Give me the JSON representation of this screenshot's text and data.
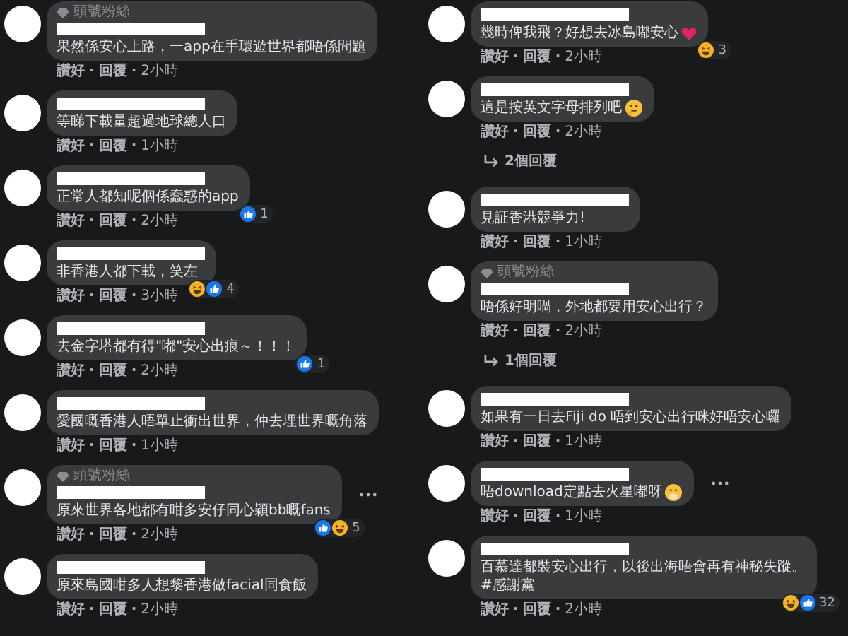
{
  "columns": [
    {
      "comments": [
        {
          "badge": "頭號粉絲",
          "text": "果然係安心上路，一app在手環遊世界都唔係問題",
          "actions": [
            {
              "kind": "like",
              "text": "讚好"
            },
            {
              "kind": "sep",
              "text": "·"
            },
            {
              "kind": "reply",
              "text": "回覆"
            },
            {
              "kind": "sep",
              "text": "·"
            },
            {
              "kind": "time",
              "text": "2小時"
            }
          ]
        },
        {
          "text": "等睇下載量超過地球總人口",
          "actions": [
            {
              "kind": "like",
              "text": "讚好"
            },
            {
              "kind": "sep",
              "text": "·"
            },
            {
              "kind": "reply",
              "text": "回覆"
            },
            {
              "kind": "sep",
              "text": "·"
            },
            {
              "kind": "time",
              "text": "1小時"
            }
          ]
        },
        {
          "text": "正常人都知呢個係蠢惑的app",
          "reactions": [
            {
              "kind": "like"
            }
          ],
          "reaction_count": "1",
          "actions": [
            {
              "kind": "like",
              "text": "讚好"
            },
            {
              "kind": "sep",
              "text": "·"
            },
            {
              "kind": "reply",
              "text": "回覆"
            },
            {
              "kind": "sep",
              "text": "·"
            },
            {
              "kind": "time",
              "text": "2小時"
            }
          ]
        },
        {
          "text": "非香港人都下載，笑左",
          "reactions": [
            {
              "kind": "haha"
            },
            {
              "kind": "like"
            }
          ],
          "reaction_count": "4",
          "actions": [
            {
              "kind": "like",
              "text": "讚好"
            },
            {
              "kind": "sep",
              "text": "·"
            },
            {
              "kind": "reply",
              "text": "回覆"
            },
            {
              "kind": "sep",
              "text": "·"
            },
            {
              "kind": "time",
              "text": "3小時"
            }
          ]
        },
        {
          "text": "去金字塔都有得\"嘟\"安心出痕～！！！",
          "reactions": [
            {
              "kind": "like"
            }
          ],
          "reaction_count": "1",
          "actions": [
            {
              "kind": "like",
              "text": "讚好"
            },
            {
              "kind": "sep",
              "text": "·"
            },
            {
              "kind": "reply",
              "text": "回覆"
            },
            {
              "kind": "sep",
              "text": "·"
            },
            {
              "kind": "time",
              "text": "2小時"
            }
          ]
        },
        {
          "text": "愛國嘅香港人唔單止衝出世界，仲去埋世界嘅角落",
          "actions": [
            {
              "kind": "like",
              "text": "讚好"
            },
            {
              "kind": "sep",
              "text": "·"
            },
            {
              "kind": "reply",
              "text": "回覆"
            },
            {
              "kind": "sep",
              "text": "·"
            },
            {
              "kind": "time",
              "text": "1小時"
            }
          ]
        },
        {
          "badge": "頭號粉絲",
          "text": "原來世界各地都有咁多安仔同心穎bb嘅fans",
          "reactions": [
            {
              "kind": "like"
            },
            {
              "kind": "haha"
            }
          ],
          "reaction_count": "5",
          "more": true,
          "actions": [
            {
              "kind": "like",
              "text": "讚好"
            },
            {
              "kind": "sep",
              "text": "·"
            },
            {
              "kind": "reply",
              "text": "回覆"
            },
            {
              "kind": "sep",
              "text": "·"
            },
            {
              "kind": "time",
              "text": "2小時"
            }
          ]
        },
        {
          "text": "原來島國咁多人想黎香港做facial同食飯",
          "actions": [
            {
              "kind": "like",
              "text": "讚好"
            },
            {
              "kind": "sep",
              "text": "·"
            },
            {
              "kind": "reply",
              "text": "回覆"
            },
            {
              "kind": "sep",
              "text": "·"
            },
            {
              "kind": "time",
              "text": "2小時"
            }
          ]
        }
      ]
    },
    {
      "comments": [
        {
          "text": "幾時俾我飛？好想去冰島嘟安心",
          "emoji": {
            "kind": "heart"
          },
          "reactions": [
            {
              "kind": "haha"
            }
          ],
          "reaction_count": "3",
          "actions": [
            {
              "kind": "like",
              "text": "讚好"
            },
            {
              "kind": "sep",
              "text": "·"
            },
            {
              "kind": "reply",
              "text": "回覆"
            },
            {
              "kind": "sep",
              "text": "·"
            },
            {
              "kind": "time",
              "text": "2小時"
            }
          ]
        },
        {
          "text": "這是按英文字母排列吧",
          "emoji": {
            "kind": "thinking"
          },
          "actions": [
            {
              "kind": "like",
              "text": "讚好"
            },
            {
              "kind": "sep",
              "text": "·"
            },
            {
              "kind": "reply",
              "text": "回覆"
            },
            {
              "kind": "sep",
              "text": "·"
            },
            {
              "kind": "time",
              "text": "2小時"
            }
          ],
          "replies": "2個回覆"
        },
        {
          "text": "見証香港競爭力!",
          "actions": [
            {
              "kind": "like",
              "text": "讚好"
            },
            {
              "kind": "sep",
              "text": "·"
            },
            {
              "kind": "reply",
              "text": "回覆"
            },
            {
              "kind": "sep",
              "text": "·"
            },
            {
              "kind": "time",
              "text": "1小時"
            }
          ]
        },
        {
          "badge": "頭號粉絲",
          "text": "唔係好明喎，外地都要用安心出行？",
          "actions": [
            {
              "kind": "like",
              "text": "讚好"
            },
            {
              "kind": "sep",
              "text": "·"
            },
            {
              "kind": "reply",
              "text": "回覆"
            },
            {
              "kind": "sep",
              "text": "·"
            },
            {
              "kind": "time",
              "text": "2小時"
            }
          ],
          "replies": "1個回覆"
        },
        {
          "text": "如果有一日去Fiji do 唔到安心出行咪好唔安心囉",
          "actions": [
            {
              "kind": "like",
              "text": "讚好"
            },
            {
              "kind": "sep",
              "text": "·"
            },
            {
              "kind": "reply",
              "text": "回覆"
            },
            {
              "kind": "sep",
              "text": "·"
            },
            {
              "kind": "time",
              "text": "1小時"
            }
          ]
        },
        {
          "text": "唔download定點去火星嘟呀",
          "emoji": {
            "kind": "mouth"
          },
          "more": true,
          "actions": [
            {
              "kind": "like",
              "text": "讚好"
            },
            {
              "kind": "sep",
              "text": "·"
            },
            {
              "kind": "reply",
              "text": "回覆"
            },
            {
              "kind": "sep",
              "text": "·"
            },
            {
              "kind": "time",
              "text": "1小時"
            }
          ]
        },
        {
          "text": "百慕達都裝安心出行，以後出海唔會再有神秘失蹤。\n#感謝黨",
          "reactions": [
            {
              "kind": "haha"
            },
            {
              "kind": "like"
            }
          ],
          "reaction_count": "32",
          "actions": [
            {
              "kind": "like",
              "text": "讚好"
            },
            {
              "kind": "sep",
              "text": "·"
            },
            {
              "kind": "reply",
              "text": "回覆"
            },
            {
              "kind": "sep",
              "text": "·"
            },
            {
              "kind": "time",
              "text": "2小時"
            }
          ]
        }
      ]
    }
  ]
}
